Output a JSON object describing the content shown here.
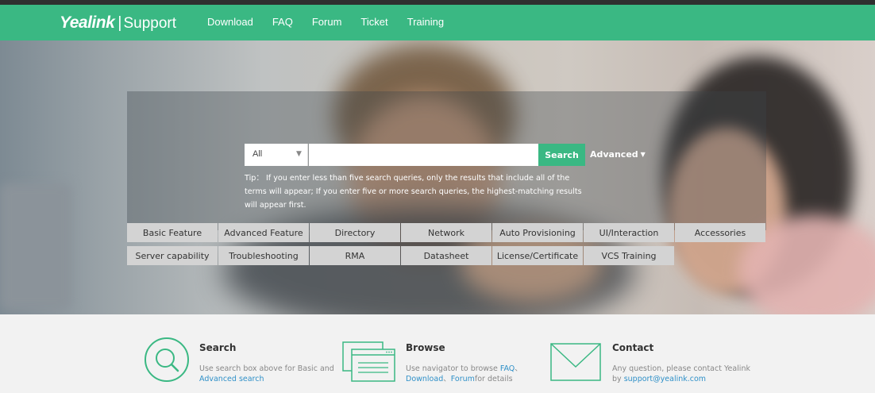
{
  "header": {
    "brand": "Yealink",
    "separator": "|",
    "subtitle": "Support",
    "nav": [
      "Download",
      "FAQ",
      "Forum",
      "Ticket",
      "Training"
    ]
  },
  "search": {
    "scope_value": "All",
    "input_value": "",
    "button_label": "Search",
    "advanced_label": "Advanced",
    "tip": "Tip： If you enter less than five search queries, only the results that include all of the terms will appear; If you enter five or more search queries, the highest-matching results will appear first."
  },
  "categories": {
    "row1": [
      "Basic Feature",
      "Advanced Feature",
      "Directory",
      "Network",
      "Auto Provisioning",
      "UI/Interaction",
      "Accessories"
    ],
    "row2": [
      "Server capability",
      "Troubleshooting",
      "RMA",
      "Datasheet",
      "License/Certificate",
      "VCS Training"
    ]
  },
  "features": {
    "search": {
      "title": "Search",
      "desc_prefix": "Use search box above for Basic and ",
      "desc_link": "Advanced search"
    },
    "browse": {
      "title": "Browse",
      "desc_prefix": "Use navigator to browse ",
      "link_faq": "FAQ",
      "sep1": "、",
      "link_download": "Download",
      "sep2": "、",
      "link_forum": "Forum",
      "desc_suffix": "for details"
    },
    "contact": {
      "title": "Contact",
      "desc_prefix": "Any question, please contact Yealink by ",
      "desc_link": "support@yealink.com"
    }
  },
  "colors": {
    "brand_green": "#3ab883",
    "link_blue": "#2f90c8",
    "category_bg": "#d3d3d3"
  }
}
